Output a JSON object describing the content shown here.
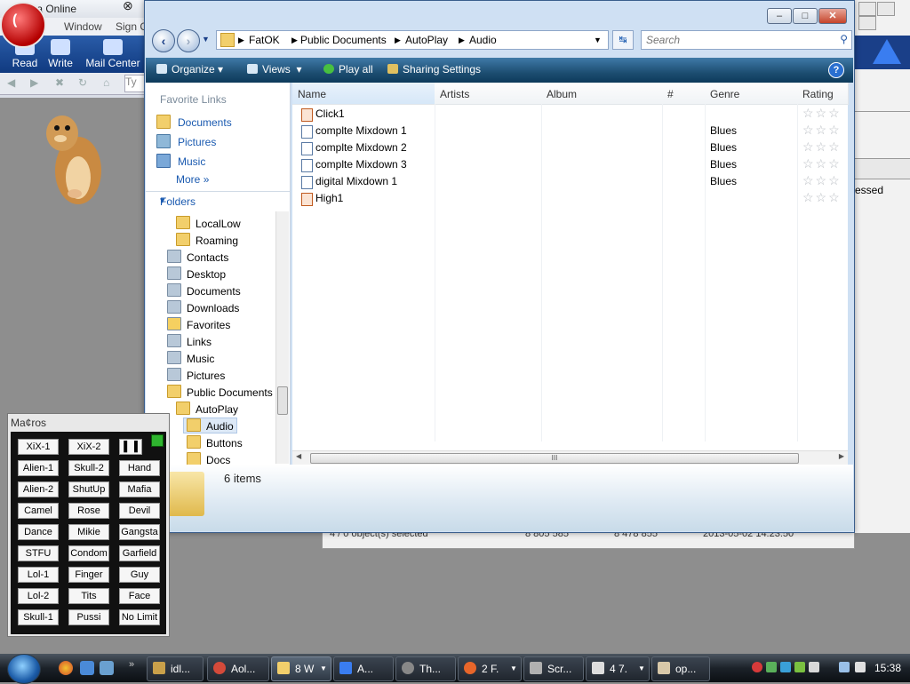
{
  "aol": {
    "title_partial": "erica Online",
    "menu_partial": [
      "nt",
      "Window",
      "Sign C"
    ],
    "toolbar": [
      {
        "label": "Read",
        "icon": "mail-read-icon"
      },
      {
        "label": "Write",
        "icon": "pencil-icon"
      },
      {
        "label": "Mail Center",
        "icon": "mail-center-icon"
      }
    ],
    "nav_partial": "Ty",
    "right_text_partial": "essed",
    "status_fragments": [
      "4 / 0 object(s) selected",
      "8 805 585",
      "8 478 855",
      "2013-05-02 14:23:50"
    ]
  },
  "explorer": {
    "window_controls": {
      "minimize": "–",
      "maximize": "□",
      "close": "✕"
    },
    "nav": {
      "back_icon": "back-arrow-icon",
      "forward_icon": "forward-arrow-icon"
    },
    "breadcrumb": [
      "FatOK",
      "Public Documents",
      "AutoPlay",
      "Audio"
    ],
    "search_placeholder": "Search",
    "commands": [
      "Organize",
      "Views",
      "Play all",
      "Sharing Settings"
    ],
    "help_label": "?",
    "favorite_links_header": "Favorite Links",
    "favorite_links": [
      "Documents",
      "Pictures",
      "Music",
      "More"
    ],
    "folders_header": "Folders",
    "tree": [
      {
        "label": "LocalLow",
        "level": 3,
        "special": false
      },
      {
        "label": "Roaming",
        "level": 3,
        "special": false
      },
      {
        "label": "Contacts",
        "level": 2,
        "special": true
      },
      {
        "label": "Desktop",
        "level": 2,
        "special": true
      },
      {
        "label": "Documents",
        "level": 2,
        "special": true
      },
      {
        "label": "Downloads",
        "level": 2,
        "special": true
      },
      {
        "label": "Favorites",
        "level": 2,
        "special": true
      },
      {
        "label": "Links",
        "level": 2,
        "special": true
      },
      {
        "label": "Music",
        "level": 2,
        "special": true
      },
      {
        "label": "Pictures",
        "level": 2,
        "special": true
      },
      {
        "label": "Public Documents",
        "level": 2,
        "special": false
      },
      {
        "label": "AutoPlay",
        "level": 3,
        "special": false
      },
      {
        "label": "Audio",
        "level": 4,
        "special": false,
        "selected": true
      },
      {
        "label": "Buttons",
        "level": 4,
        "special": false
      },
      {
        "label": "Docs",
        "level": 4,
        "special": false
      }
    ],
    "columns": [
      "Name",
      "Artists",
      "Album",
      "#",
      "Genre",
      "Rating"
    ],
    "files": [
      {
        "name": "Click1",
        "genre": "",
        "type": "vlc"
      },
      {
        "name": "complte Mixdown 1",
        "genre": "Blues",
        "type": "audio"
      },
      {
        "name": "complte Mixdown 2",
        "genre": "Blues",
        "type": "audio"
      },
      {
        "name": "complte Mixdown 3",
        "genre": "Blues",
        "type": "audio"
      },
      {
        "name": "digital Mixdown 1",
        "genre": "Blues",
        "type": "audio"
      },
      {
        "name": "High1",
        "genre": "",
        "type": "vlc"
      }
    ],
    "rating_stars": "☆☆☆",
    "item_count": "6 items",
    "hscroll_grip": "III"
  },
  "macros": {
    "title": "Ma¢ros",
    "buttons": [
      [
        "XiX-1",
        "XiX-2",
        "▌▐"
      ],
      [
        "Alien-1",
        "Skull-2",
        "Hand"
      ],
      [
        "Alien-2",
        "ShutUp",
        "Mafia"
      ],
      [
        "Camel",
        "Rose",
        "Devil"
      ],
      [
        "Dance",
        "Mikie",
        "Gangsta"
      ],
      [
        "STFU",
        "Condom",
        "Garfield"
      ],
      [
        "Lol-1",
        "Finger",
        "Guy"
      ],
      [
        "Lol-2",
        "Tits",
        "Face"
      ],
      [
        "Skull-1",
        "Pussi",
        "No Limit"
      ]
    ]
  },
  "taskbar": {
    "buttons": [
      {
        "label": "idl...",
        "icon": "app-icon"
      },
      {
        "label": "Aol...",
        "icon": "aol-icon"
      },
      {
        "label": "8 W",
        "icon": "folder-icon",
        "active": true
      },
      {
        "label": "A...",
        "icon": "aol-triangle-icon"
      },
      {
        "label": "Th...",
        "icon": "headset-icon"
      },
      {
        "label": "2 F.",
        "icon": "firefox-icon"
      },
      {
        "label": "Scr...",
        "icon": "speaker-icon"
      },
      {
        "label": "4 7.",
        "icon": "window-icon"
      },
      {
        "label": "op...",
        "icon": "paint-icon"
      }
    ],
    "clock": "15:38"
  }
}
